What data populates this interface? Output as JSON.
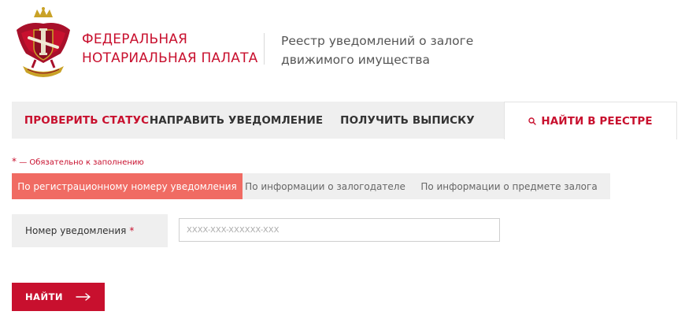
{
  "header": {
    "org_line1": "ФЕДЕРАЛЬНАЯ",
    "org_line2": "НОТАРИАЛЬНАЯ ПАЛАТА",
    "registry_line1": "Реестр уведомлений о залоге",
    "registry_line2": "движимого имущества"
  },
  "tabs": [
    {
      "label": "ПРОВЕРИТЬ СТАТУС"
    },
    {
      "label": "НАПРАВИТЬ УВЕДОМЛЕНИЕ"
    },
    {
      "label": "ПОЛУЧИТЬ ВЫПИСКУ"
    },
    {
      "label": "НАЙТИ В РЕЕСТРЕ",
      "active": true
    }
  ],
  "required_note": {
    "star": "*",
    "text": "— Обязательно к заполнению"
  },
  "subtabs": [
    {
      "label": "По регистрационному номеру уведомления",
      "active": true
    },
    {
      "label": "По информации о залогодателе"
    },
    {
      "label": "По информации о предмете залога"
    }
  ],
  "form": {
    "field_label": "Номер уведомления",
    "required_star": "*",
    "placeholder": "XXXX-XXX-XXXXXX-XXX",
    "value": ""
  },
  "search_button": {
    "label": "НАЙТИ"
  },
  "colors": {
    "brand": "#c8102e",
    "active_subtab": "#f06b63",
    "tab_bg": "#efefef"
  }
}
